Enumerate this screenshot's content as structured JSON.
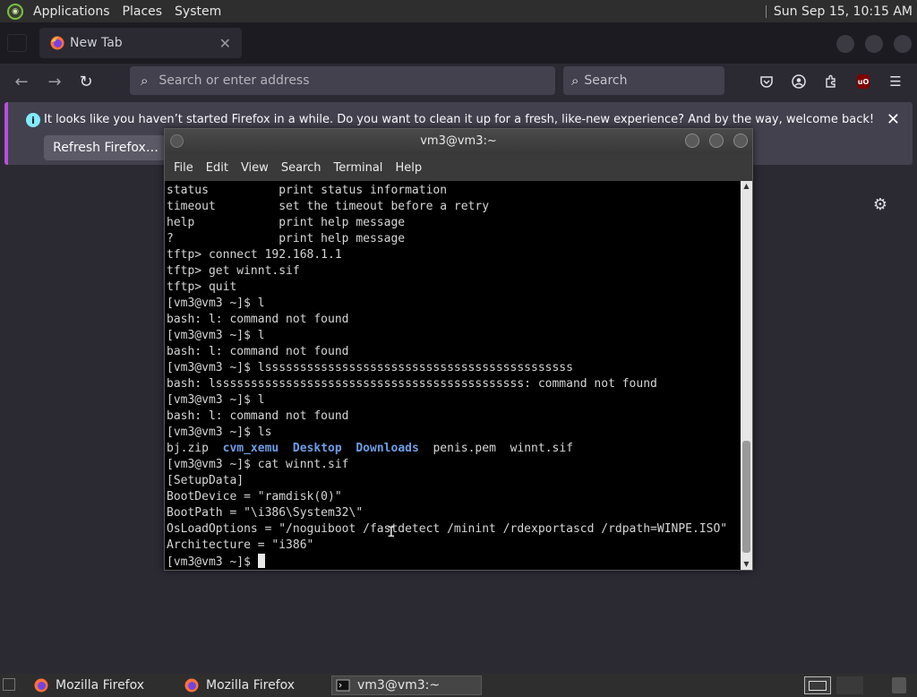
{
  "panel": {
    "menus": [
      "Applications",
      "Places",
      "System"
    ],
    "clock": "Sun Sep 15, 10:15 AM"
  },
  "firefox": {
    "tab_title": "New Tab",
    "tab_close": "✕",
    "url_placeholder": "Search or enter address",
    "search_placeholder": "Search",
    "notification": {
      "message": "It looks like you haven’t started Firefox in a while. Do you want to clean it up for a fresh, like-new experience? And by the way, welcome back!",
      "button_label": "Refresh Firefox…",
      "close": "✕"
    },
    "accent_color": "#b84ee0"
  },
  "terminal": {
    "title": "vm3@vm3:~",
    "menus": [
      "File",
      "Edit",
      "View",
      "Search",
      "Terminal",
      "Help"
    ],
    "lines": [
      "status          print status information",
      "timeout         set the timeout before a retry",
      "help            print help message",
      "?               print help message",
      "tftp> connect 192.168.1.1",
      "tftp> get winnt.sif",
      "tftp> quit",
      "[vm3@vm3 ~]$ l",
      "bash: l: command not found",
      "[vm3@vm3 ~]$ l",
      "bash: l: command not found",
      "[vm3@vm3 ~]$ lssssssssssssssssssssssssssssssssssssssssssss",
      "bash: lssssssssssssssssssssssssssssssssssssssssssss: command not found",
      "[vm3@vm3 ~]$ l",
      "bash: l: command not found",
      "[vm3@vm3 ~]$ ls"
    ],
    "ls_output": [
      {
        "name": "bj.zip",
        "dir": false
      },
      {
        "name": "cvm_xemu",
        "dir": true
      },
      {
        "name": "Desktop",
        "dir": true
      },
      {
        "name": "Downloads",
        "dir": true
      },
      {
        "name": "penis.pem",
        "dir": false
      },
      {
        "name": "winnt.sif",
        "dir": false
      }
    ],
    "lines_after": [
      "[vm3@vm3 ~]$ cat winnt.sif",
      "[SetupData]",
      "BootDevice = \"ramdisk(0)\"",
      "BootPath = \"\\i386\\System32\\\"",
      "OsLoadOptions = \"/noguiboot /fastdetect /minint /rdexportascd /rdpath=WINPE.ISO\"",
      "Architecture = \"i386\""
    ],
    "prompt": "[vm3@vm3 ~]$ ",
    "dir_color": "#6d9de6"
  },
  "taskbar": {
    "tasks": [
      "Mozilla Firefox",
      "Mozilla Firefox",
      "vm3@vm3:~"
    ]
  }
}
